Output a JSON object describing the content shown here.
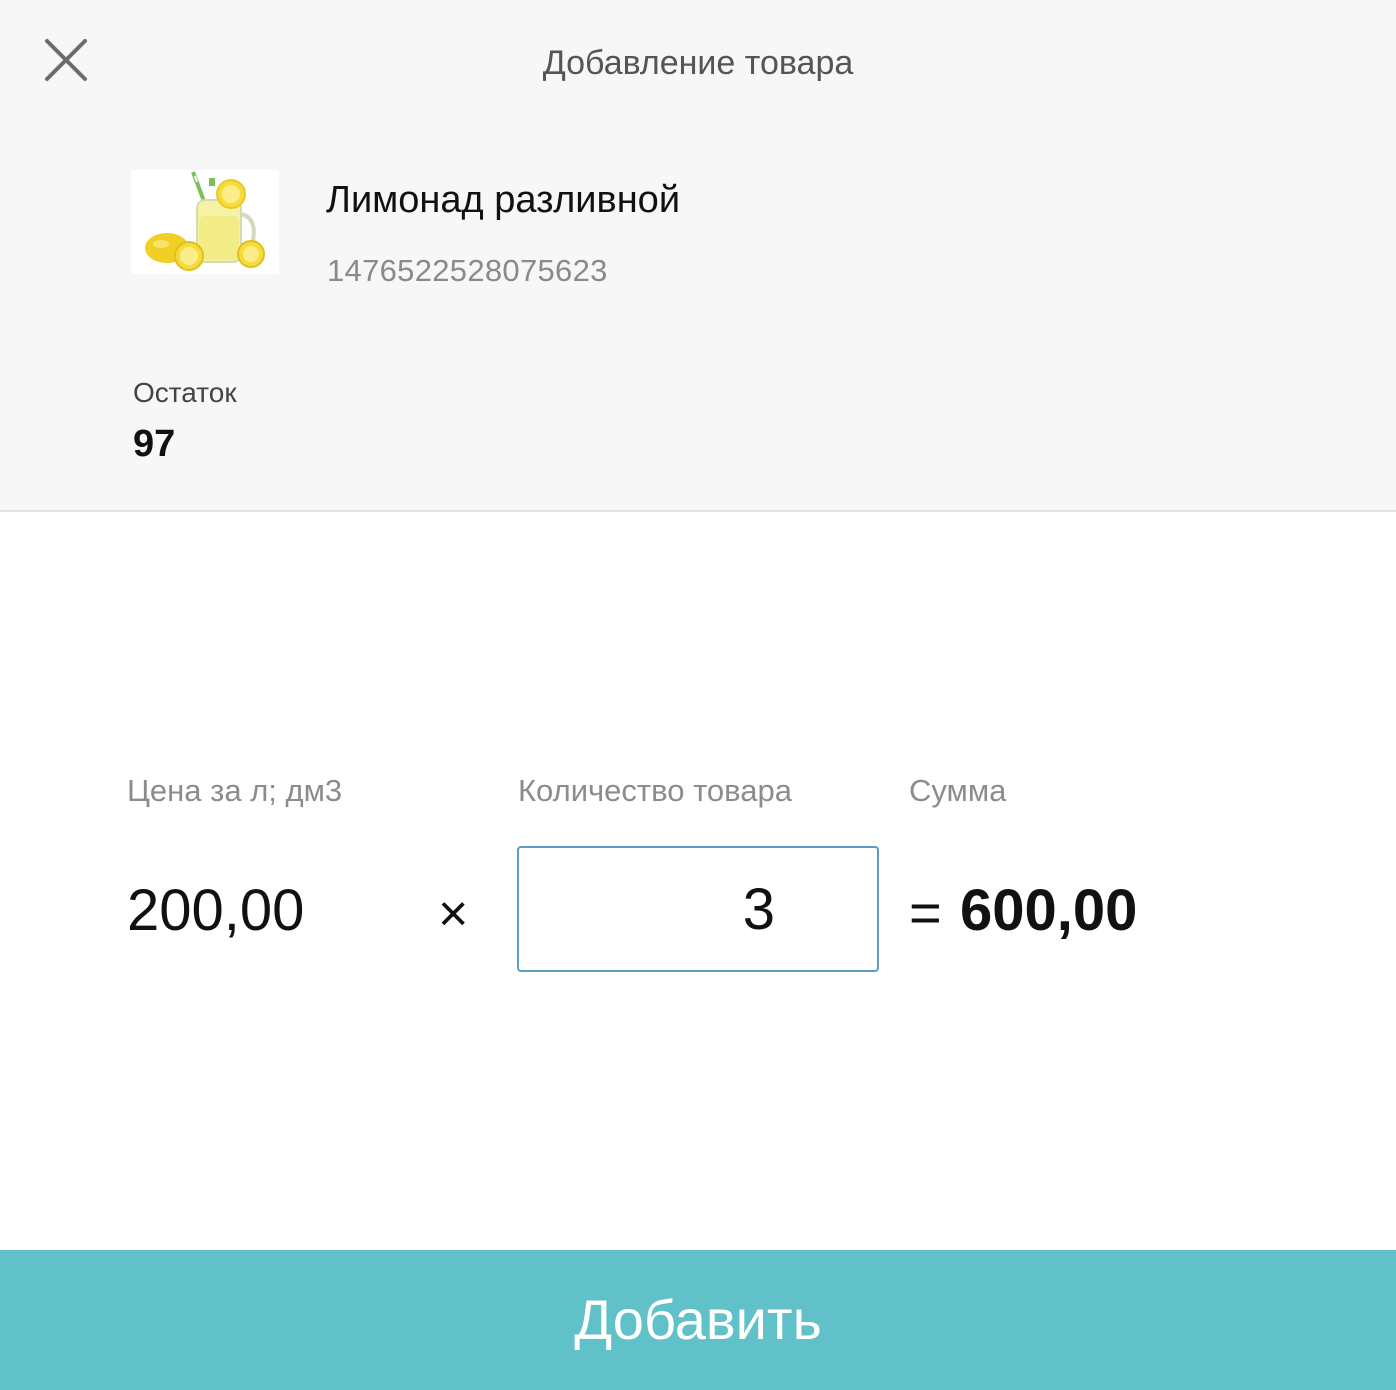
{
  "header": {
    "title": "Добавление товара",
    "close_icon": "close-icon"
  },
  "product": {
    "image_alt": "lemonade-image",
    "name": "Лимонад разливной",
    "barcode": "1476522528075623"
  },
  "stock": {
    "label": "Остаток",
    "value": "97"
  },
  "calculation": {
    "price_label": "Цена за л; дм3",
    "quantity_label": "Количество товара",
    "sum_label": "Сумма",
    "price_value": "200,00",
    "times_symbol": "×",
    "quantity_value": "3",
    "equals_symbol": "=",
    "sum_value": "600,00"
  },
  "footer": {
    "add_label": "Добавить",
    "accent_color": "#61c1c8"
  }
}
